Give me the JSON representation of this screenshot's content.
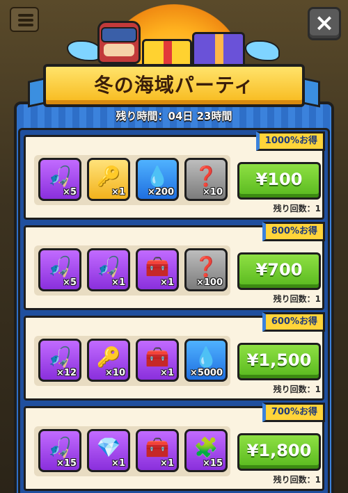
{
  "event": {
    "title": "冬の海域パーティ",
    "timer": "残り時間：04日 23時間"
  },
  "colors": {
    "panel_blue": "#3b82dc",
    "buy_green": "#58b81e",
    "tag_yellow": "#ffd43a",
    "banner_gold": "#f7b91c"
  },
  "close_icon": "×",
  "offers": [
    {
      "tag": "1000%お得",
      "price": "¥100",
      "remaining": "残り回数：1",
      "items": [
        {
          "icon": "fishing-lure-icon",
          "glyph": "🎣",
          "qty": "×5",
          "color": "purple"
        },
        {
          "icon": "key-icon",
          "glyph": "🔑",
          "qty": "×1",
          "color": "gold"
        },
        {
          "icon": "oil-drop-icon",
          "glyph": "💧",
          "qty": "×200",
          "color": "blue"
        },
        {
          "icon": "mystery-map-icon",
          "glyph": "❓",
          "qty": "×10",
          "color": "gray"
        }
      ]
    },
    {
      "tag": "800%お得",
      "price": "¥700",
      "remaining": "残り回数：1",
      "items": [
        {
          "icon": "fishing-lure-icon",
          "glyph": "🎣",
          "qty": "×5",
          "color": "purple"
        },
        {
          "icon": "fishing-rod-icon",
          "glyph": "🎣",
          "qty": "×1",
          "color": "purple"
        },
        {
          "icon": "treasure-chest-icon",
          "glyph": "🧰",
          "qty": "×1",
          "color": "purple"
        },
        {
          "icon": "mystery-map-icon",
          "glyph": "❓",
          "qty": "×100",
          "color": "gray"
        }
      ]
    },
    {
      "tag": "600%お得",
      "price": "¥1,500",
      "remaining": "残り回数：1",
      "items": [
        {
          "icon": "fishing-lure-icon",
          "glyph": "🎣",
          "qty": "×12",
          "color": "purple"
        },
        {
          "icon": "key-icon",
          "glyph": "🔑",
          "qty": "×10",
          "color": "purple"
        },
        {
          "icon": "treasure-chest-icon",
          "glyph": "🧰",
          "qty": "×1",
          "color": "purple"
        },
        {
          "icon": "oil-drop-icon",
          "glyph": "💧",
          "qty": "×5000",
          "color": "blue"
        }
      ]
    },
    {
      "tag": "700%お得",
      "price": "¥1,800",
      "remaining": "残り回数：1",
      "items": [
        {
          "icon": "fishing-lure-icon",
          "glyph": "🎣",
          "qty": "×15",
          "color": "purple"
        },
        {
          "icon": "gem-chest-icon",
          "glyph": "💎",
          "qty": "×1",
          "color": "purple"
        },
        {
          "icon": "treasure-chest-icon",
          "glyph": "🧰",
          "qty": "×1",
          "color": "purple"
        },
        {
          "icon": "puzzle-piece-icon",
          "glyph": "🧩",
          "qty": "×15",
          "color": "purple"
        }
      ]
    }
  ]
}
